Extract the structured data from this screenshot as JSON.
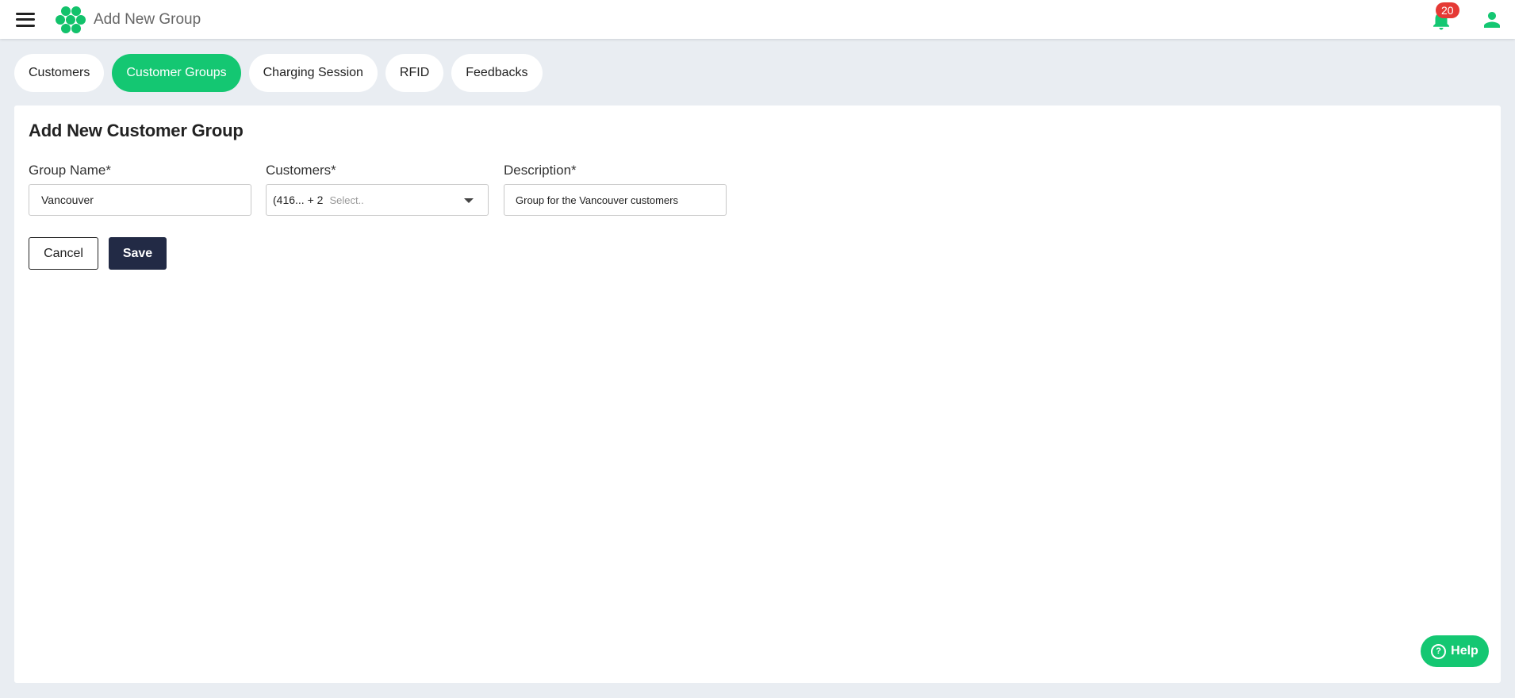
{
  "header": {
    "title": "Add New Group",
    "notifications_count": "20",
    "brand_color": "#14c772"
  },
  "tabs": [
    {
      "label": "Customers",
      "active": false
    },
    {
      "label": "Customer Groups",
      "active": true
    },
    {
      "label": "Charging Session",
      "active": false
    },
    {
      "label": "RFID",
      "active": false
    },
    {
      "label": "Feedbacks",
      "active": false
    }
  ],
  "form": {
    "title": "Add New Customer Group",
    "group_name": {
      "label": "Group Name*",
      "value": "Vancouver"
    },
    "customers": {
      "label": "Customers*",
      "selected": "(416... + 2",
      "placeholder": "Select.."
    },
    "description": {
      "label": "Description*",
      "value": "Group for the Vancouver customers"
    },
    "cancel_label": "Cancel",
    "save_label": "Save"
  },
  "help": {
    "label": "Help",
    "icon": "question-circle-icon"
  }
}
